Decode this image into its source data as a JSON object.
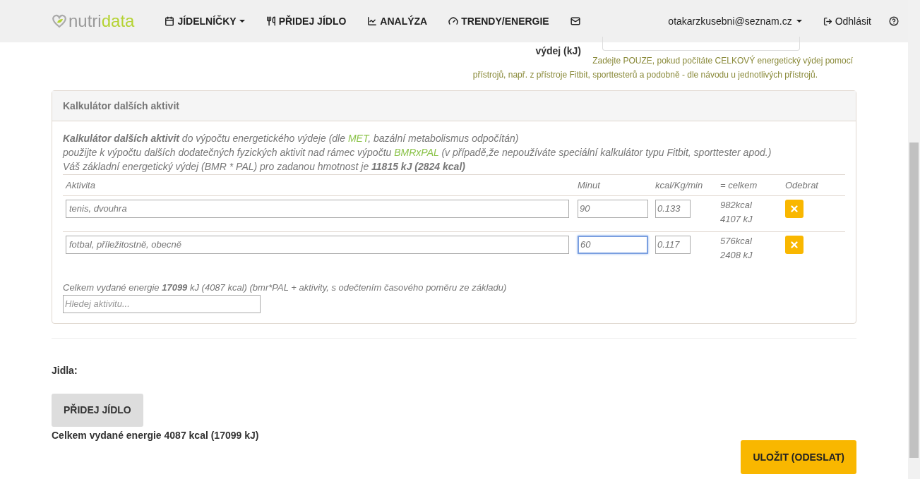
{
  "navbar": {
    "logo": {
      "part_1": "nutri",
      "part_2": "data"
    },
    "items": [
      {
        "kind": "menu",
        "label": "JÍDELNÍČKY"
      },
      {
        "kind": "link",
        "label": "PŘIDEJ JÍDLO"
      },
      {
        "kind": "link",
        "label": "ANALÝZA"
      },
      {
        "kind": "link",
        "label": "TRENDY/ENERGIE"
      },
      {
        "kind": "icon"
      }
    ],
    "user": "otakarzkusebni@seznam.cz",
    "logout": "Odhlásit"
  },
  "expenditure": {
    "label": "výdej (kJ)",
    "hint_line_1": "Zadejte POUZE, pokud počítáte CELKOVÝ energetický výdej pomocí",
    "hint_line_2": "přístrojů, např. z přístroje Fitbit, sporttesterů a podobně - dle návodu u jednotlivých přístrojů."
  },
  "calculator": {
    "title": "Kalkulátor dalších aktivit",
    "intro": [
      [
        {
          "kind": "bold",
          "text": "Kalkulátor dalších aktivit"
        },
        {
          "kind": "plain",
          "text": " do výpočtu energetického výdeje (dle "
        },
        {
          "kind": "link",
          "text": "MET"
        },
        {
          "kind": "plain",
          "text": ", bazální metabolismus odpočítán)"
        }
      ],
      [
        {
          "kind": "plain",
          "text": "použijte k výpočtu dalších dodatečných fyzických aktivit nad rámec výpočtu "
        },
        {
          "kind": "link",
          "text": "BMRxPAL"
        },
        {
          "kind": "plain",
          "text": " (v případě,že nepoužíváte speciální kalkulátor typu Fitbit, sporttester apod.)"
        }
      ],
      [
        {
          "kind": "plain",
          "text": "Váš základní energetický výdej (BMR * PAL) pro zadanou hmotnost je "
        },
        {
          "kind": "bold",
          "text": "11815 kJ (2824 kcal)"
        }
      ]
    ],
    "columns": [
      "Aktivita",
      "Minut",
      "kcal/Kg/min",
      "= celkem",
      "Odebrat"
    ],
    "rows": [
      {
        "activity": "tenis, dvouhra",
        "minutes": "90",
        "minutes_focused": false,
        "rate": "0.133",
        "kcal": "982kcal",
        "kj": "4107 kJ"
      },
      {
        "activity": "fotbal, příležitostně, obecně",
        "minutes": "60",
        "minutes_focused": true,
        "rate": "0.117",
        "kcal": "576kcal",
        "kj": "2408 kJ"
      }
    ],
    "total": "Celkem vydané energie **17099** kJ (4087 kcal) (bmr*PAL + aktivity, s odečtením časového poměru ze základu)",
    "search": {
      "placeholder": "Hledej aktivitu..."
    }
  },
  "meals_label": "Jidla:",
  "add_meal": "PŘIDEJ JÍDLO",
  "summary": "Celkem vydané energie 4087 kcal (17099 kJ)",
  "save": "ULOŽIT (ODESLAT)"
}
